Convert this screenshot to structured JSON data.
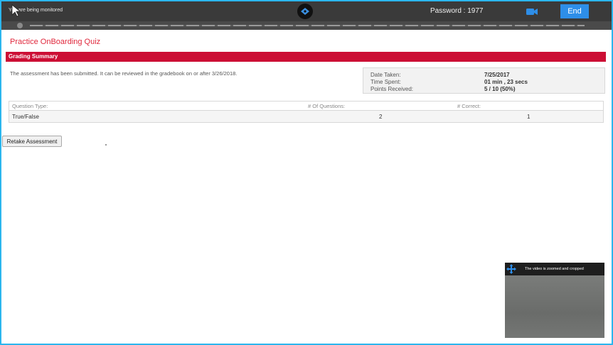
{
  "monitor_bar": {
    "message": "You are being monitored",
    "password": "Password : 1977",
    "end_label": "End"
  },
  "quiz": {
    "title": "Practice OnBoarding Quiz",
    "section": "Grading Summary",
    "submitted_message": "The assessment has been submitted. It can be reviewed in the gradebook on or after 3/26/2018."
  },
  "summary": {
    "date_taken_label": "Date Taken:",
    "date_taken": "7/25/2017",
    "time_spent_label": "Time Spent:",
    "time_spent": "01 min , 23 secs",
    "points_label": "Points Received:",
    "points": "5 / 10  (50%)"
  },
  "questions_table": {
    "headers": [
      "Question Type:",
      "# Of Questions:",
      "# Correct:"
    ],
    "rows": [
      [
        "True/False",
        "2",
        "1"
      ]
    ]
  },
  "retake_label": "Retake Assessment",
  "video": {
    "message": "The video is zoomed and cropped"
  },
  "colors": {
    "accent_red": "#cc0f35",
    "frame_blue": "#2bb6ee",
    "end_button_blue": "#2e8ee8"
  }
}
